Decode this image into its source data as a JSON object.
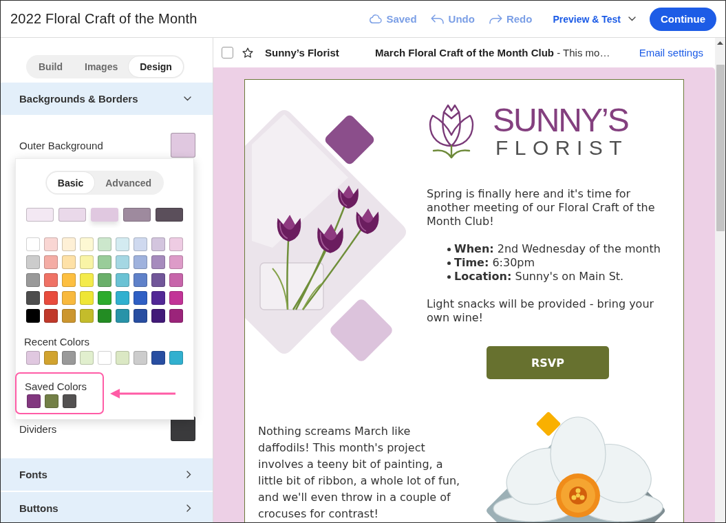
{
  "top_bar": {
    "title": "2022 Floral Craft of the Month",
    "actions": [
      {
        "kind": "saved",
        "label": "Saved",
        "disabled": true
      },
      {
        "kind": "undo",
        "label": "Undo",
        "disabled": true
      },
      {
        "kind": "redo",
        "label": "Redo",
        "disabled": true
      }
    ],
    "preview_menu": "Preview & Test",
    "continue_button": "Continue"
  },
  "sidebar": {
    "tabs": [
      {
        "label": "Build",
        "selected": false
      },
      {
        "label": "Images",
        "selected": false
      },
      {
        "label": "Design",
        "selected": true
      }
    ],
    "sections": [
      {
        "title": "Backgrounds & Borders",
        "expanded": true,
        "rows": [
          {
            "label": "Outer Background",
            "color": "#e0c8e0"
          },
          {
            "label": "Dividers",
            "color": "#3a3a3c"
          }
        ]
      },
      {
        "title": "Fonts",
        "expanded": false
      },
      {
        "title": "Buttons",
        "expanded": false
      }
    ],
    "color_picker": {
      "modes": [
        {
          "label": "Basic",
          "selected": true
        },
        {
          "label": "Advanced",
          "selected": false
        }
      ],
      "shades": [
        {
          "color": "#f3e8f3",
          "selected": false
        },
        {
          "color": "#ead9ea",
          "selected": false
        },
        {
          "color": "#e0c8e0",
          "selected": true
        },
        {
          "color": "#9e8a9e",
          "selected": false
        },
        {
          "color": "#5b4f5b",
          "selected": false
        }
      ],
      "palette": [
        [
          {
            "color": "#ffffff"
          },
          {
            "color": "#f9d6d3"
          },
          {
            "color": "#fef0d6"
          },
          {
            "color": "#fdf8d3"
          },
          {
            "color": "#cce7cc"
          },
          {
            "color": "#d3ebf1"
          },
          {
            "color": "#cfd9ef"
          },
          {
            "color": "#d3c5de"
          },
          {
            "color": "#eecce3"
          }
        ],
        [
          {
            "color": "#cccccc"
          },
          {
            "color": "#f4ada5"
          },
          {
            "color": "#fee1a7"
          },
          {
            "color": "#f9f4a6"
          },
          {
            "color": "#99cc99"
          },
          {
            "color": "#a5d7e3"
          },
          {
            "color": "#9fb2dd"
          },
          {
            "color": "#a68bbd"
          },
          {
            "color": "#dd9bc8"
          }
        ],
        [
          {
            "color": "#999999"
          },
          {
            "color": "#ef7265"
          },
          {
            "color": "#fdbf40"
          },
          {
            "color": "#f4eb4b"
          },
          {
            "color": "#6aaf6a"
          },
          {
            "color": "#6ac2d4"
          },
          {
            "color": "#5f81c9"
          },
          {
            "color": "#715699"
          },
          {
            "color": "#c765aa"
          }
        ],
        [
          {
            "color": "#4d4d4d"
          },
          {
            "color": "#e84c3d"
          },
          {
            "color": "#f8b93d"
          },
          {
            "color": "#efe636"
          },
          {
            "color": "#2dab2d"
          },
          {
            "color": "#31b0cf"
          },
          {
            "color": "#2f5fc4"
          },
          {
            "color": "#522896"
          },
          {
            "color": "#c23497"
          }
        ],
        [
          {
            "color": "#000000"
          },
          {
            "color": "#c0392b"
          },
          {
            "color": "#cc962f"
          },
          {
            "color": "#c4bc2b"
          },
          {
            "color": "#238c23"
          },
          {
            "color": "#2893a8"
          },
          {
            "color": "#284ea1"
          },
          {
            "color": "#421a78"
          },
          {
            "color": "#9b247a"
          }
        ]
      ],
      "recent_colors": {
        "label": "Recent Colors",
        "swatches": [
          {
            "color": "#e0c8e0"
          },
          {
            "color": "#d1a32f"
          },
          {
            "color": "#999999"
          },
          {
            "color": "#e1efce"
          },
          {
            "color": "#ffffff"
          },
          {
            "color": "#dbe8c4"
          },
          {
            "color": "#cccccc"
          },
          {
            "color": "#284ea1"
          },
          {
            "color": "#31b0cf"
          }
        ]
      },
      "saved_colors": {
        "label": "Saved Colors",
        "highlighted": true,
        "swatches": [
          {
            "color": "#82377f"
          },
          {
            "color": "#727f46"
          },
          {
            "color": "#535151"
          }
        ]
      }
    }
  },
  "email_header": {
    "checked": false,
    "starred": false,
    "sender": "Sunny’s Florist",
    "subject": "**March Floral Craft of the Month Club** - This mo…",
    "settings_link": "Email settings"
  },
  "email": {
    "logo": {
      "name": "SUNNY’S",
      "tagline": "FLORIST"
    },
    "intro": "Spring is finally here and it's time for another meeting of our Floral Craft of the Month Club!",
    "details": [
      "**When:** 2nd Wednesday of the month",
      "**Time:** 6:30pm",
      "**Location:** Sunny's on Main St."
    ],
    "note": "Light snacks will be provided - bring your own wine!",
    "rsvp_button": "RSVP",
    "story": "Nothing screams March like daffodils! This month's project involves a teeny bit of painting, a little bit of ribbon, a whole lot of fun, and we'll even throw in a couple of crocuses for contrast!"
  }
}
